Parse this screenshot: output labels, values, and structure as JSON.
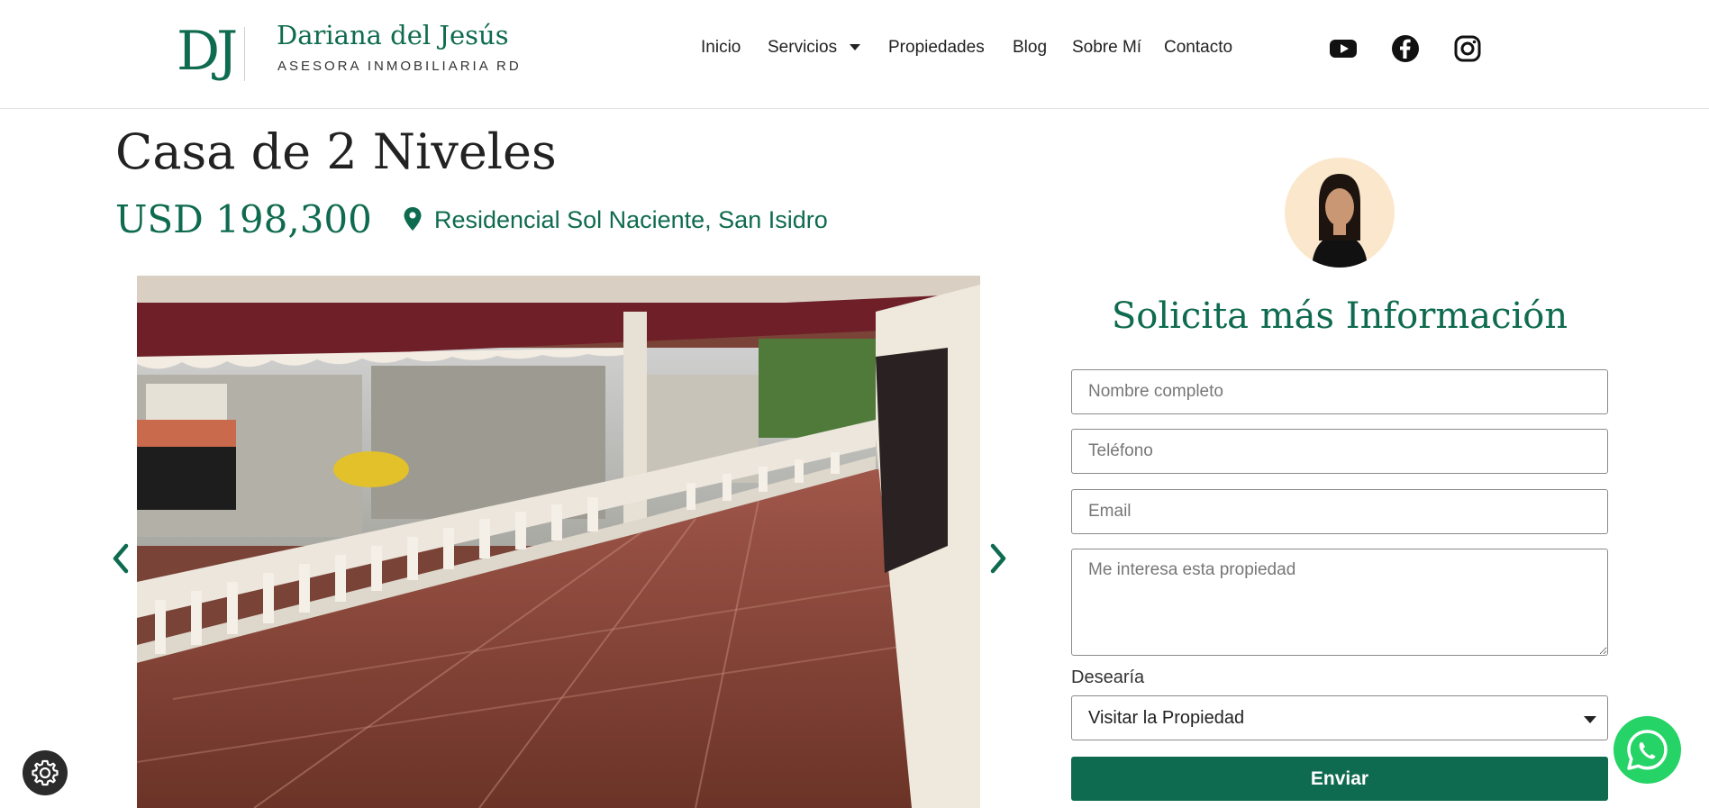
{
  "header": {
    "logo_mark": "DJ",
    "brand_name": "Dariana del Jesús",
    "brand_subtitle": "ASESORA INMOBILIARIA RD",
    "nav": {
      "inicio": "Inicio",
      "servicios": "Servicios",
      "propiedades": "Propiedades",
      "blog": "Blog",
      "sobre_mi": "Sobre Mí",
      "contacto": "Contacto"
    },
    "social_icons": [
      "youtube-icon",
      "facebook-icon",
      "instagram-icon"
    ]
  },
  "property": {
    "title": "Casa de 2 Niveles",
    "price": "USD 198,300",
    "location": "Residencial Sol Naciente, San Isidro"
  },
  "form": {
    "title": "Solicita más Información",
    "name_placeholder": "Nombre completo",
    "phone_placeholder": "Teléfono",
    "email_placeholder": "Email",
    "message_placeholder": "Me interesa esta propiedad",
    "select_label": "Desearía",
    "select_value": "Visitar la Propiedad",
    "submit_label": "Enviar"
  },
  "colors": {
    "brand_green": "#0f6b4f",
    "whatsapp_green": "#25d366"
  }
}
